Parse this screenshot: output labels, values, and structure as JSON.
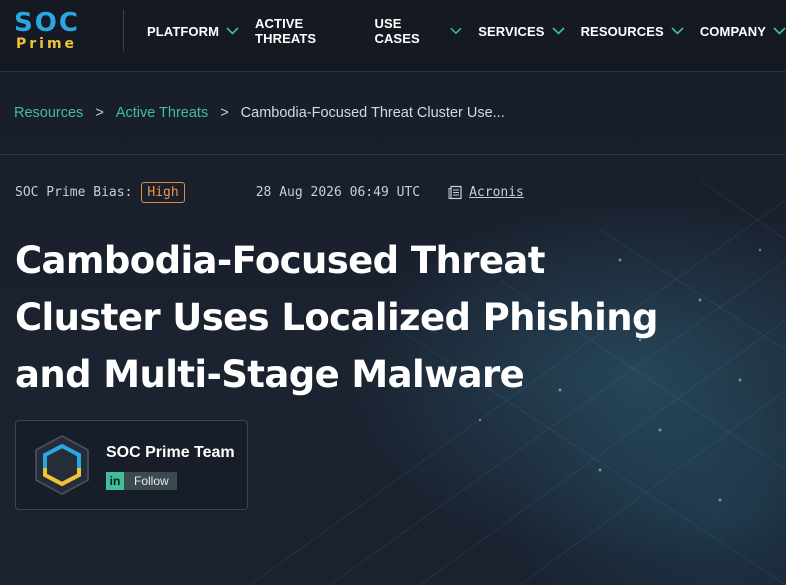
{
  "header": {
    "logo": {
      "top": "SOC",
      "bottom": "Prime"
    },
    "nav": [
      {
        "label": "PLATFORM",
        "has_dropdown": true
      },
      {
        "label": "ACTIVE THREATS",
        "has_dropdown": false
      },
      {
        "label": "USE CASES",
        "has_dropdown": true
      },
      {
        "label": "SERVICES",
        "has_dropdown": true
      },
      {
        "label": "RESOURCES",
        "has_dropdown": true
      },
      {
        "label": "COMPANY",
        "has_dropdown": true
      }
    ]
  },
  "breadcrumb": {
    "items": [
      "Resources",
      "Active Threats"
    ],
    "separator": ">",
    "current": "Cambodia-Focused Threat Cluster Use..."
  },
  "meta": {
    "bias_label": "SOC Prime Bias:",
    "bias_value": "High",
    "date": "28 Aug 2026 06:49 UTC",
    "source": "Acronis"
  },
  "article": {
    "title_lines": [
      "Cambodia-Focused Threat",
      "Cluster Uses Localized Phishing",
      "and Multi-Stage Malware"
    ]
  },
  "author": {
    "name": "SOC Prime Team",
    "follow_icon": "in",
    "follow_label": "Follow"
  },
  "colors": {
    "accent_green": "#3fbf9a",
    "bias_orange": "#f0954a",
    "logo_blue": "#2aa6e0",
    "logo_yellow": "#f2c230",
    "header_bg": "#151a22"
  },
  "icons": {
    "chevron": "chevron-down-icon",
    "source": "document-icon",
    "linkedin": "linkedin-icon"
  }
}
